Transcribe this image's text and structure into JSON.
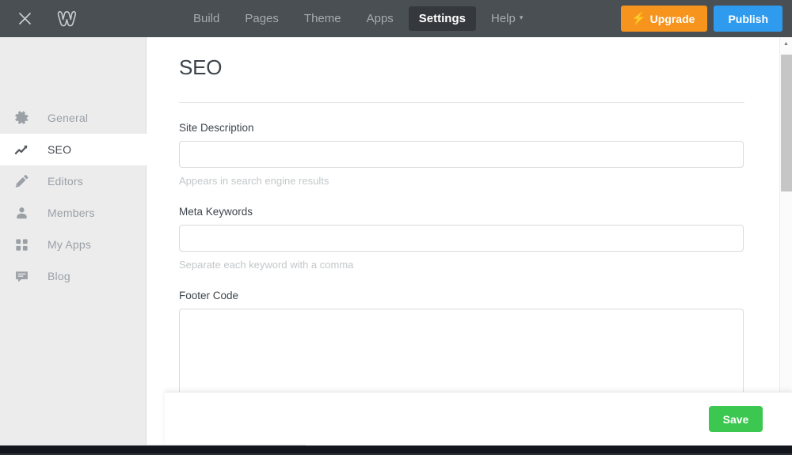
{
  "topbar": {
    "close_icon": "close-icon",
    "logo_icon": "weebly-logo-icon",
    "logo_glyph": "W",
    "nav": [
      {
        "label": "Build",
        "active": false
      },
      {
        "label": "Pages",
        "active": false
      },
      {
        "label": "Theme",
        "active": false
      },
      {
        "label": "Apps",
        "active": false
      },
      {
        "label": "Settings",
        "active": true
      },
      {
        "label": "Help",
        "active": false,
        "caret": "▾"
      }
    ],
    "upgrade_label": "Upgrade",
    "upgrade_icon": "lightning-bolt-icon",
    "upgrade_glyph": "⚡",
    "publish_label": "Publish",
    "colors": {
      "bar_bg": "#4a4f54",
      "active_tab_bg": "#35393d",
      "upgrade_bg": "#f7941e",
      "publish_bg": "#2f9bef"
    }
  },
  "sidebar": {
    "items": [
      {
        "label": "General",
        "icon": "gear-icon",
        "active": false
      },
      {
        "label": "SEO",
        "icon": "trending-up-icon",
        "active": true
      },
      {
        "label": "Editors",
        "icon": "pencil-icon",
        "active": false
      },
      {
        "label": "Members",
        "icon": "person-icon",
        "active": false
      },
      {
        "label": "My Apps",
        "icon": "grid-icon",
        "active": false
      },
      {
        "label": "Blog",
        "icon": "speech-bubble-icon",
        "active": false
      }
    ]
  },
  "main": {
    "title": "SEO",
    "fields": [
      {
        "label": "Site Description",
        "value": "",
        "placeholder": "",
        "hint": "Appears in search engine results",
        "type": "input"
      },
      {
        "label": "Meta Keywords",
        "value": "",
        "placeholder": "",
        "hint": "Separate each keyword with a comma",
        "type": "input"
      },
      {
        "label": "Footer Code",
        "value": "",
        "placeholder": "",
        "hint": "",
        "type": "textarea"
      }
    ]
  },
  "savebar": {
    "save_label": "Save",
    "save_color": "#3cc751"
  },
  "scrollbars": {
    "vertical_arrow": "▲",
    "vertical_present": true,
    "horizontal_present": true
  }
}
